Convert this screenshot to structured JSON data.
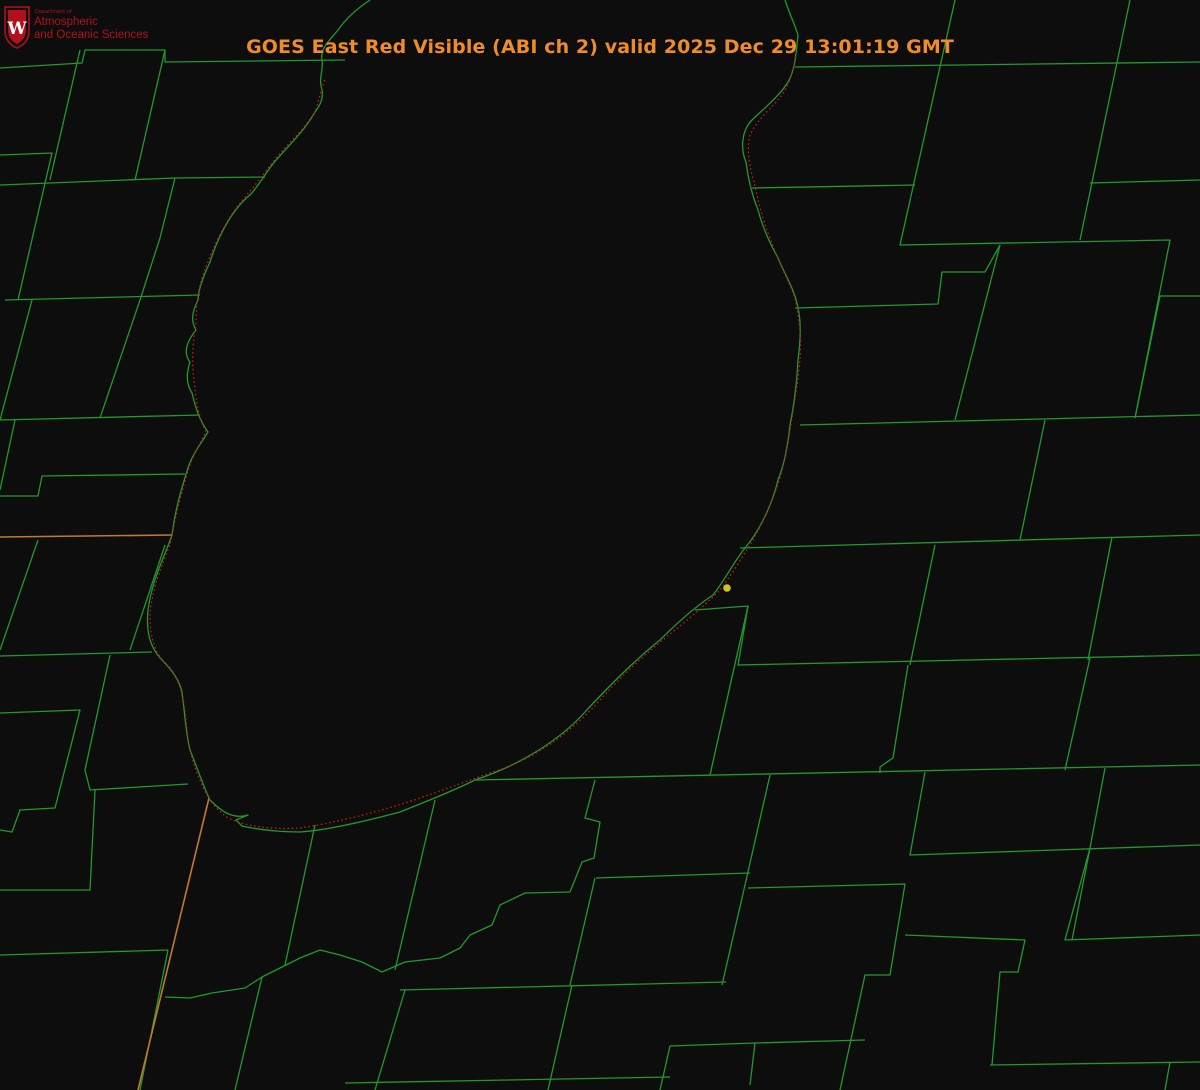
{
  "title": "GOES East Red Visible (ABI ch 2) valid 2025 Dec 29 13:01:19 GMT",
  "logo": {
    "department": "Department of",
    "line1": "Atmospheric",
    "line2": "and Oceanic Sciences",
    "shield_letter": "W"
  },
  "colors": {
    "background": "#0d0d0d",
    "title": "#f08c28",
    "county_lines": "#1f9a2b",
    "shoreline_dotted": "#d11a1a",
    "state_line": "#c07a2a",
    "marker": "#d7c21c",
    "logo_text": "#b3101d",
    "shield": "#b3101d"
  },
  "map": {
    "layers": [
      "county-boundaries",
      "lake-shoreline",
      "state-boundary",
      "location-marker"
    ]
  }
}
